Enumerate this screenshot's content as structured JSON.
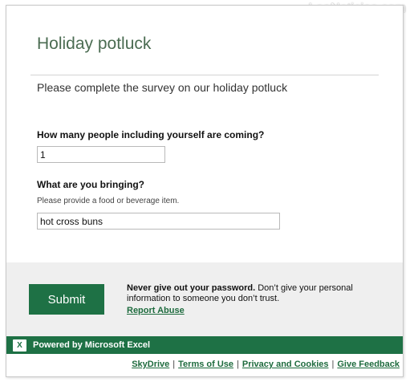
{
  "watermark": "LeaNoticias.com",
  "form": {
    "title": "Holiday potluck",
    "description": "Please complete the survey on our holiday potluck"
  },
  "questions": [
    {
      "label": "How many people including yourself are coming?",
      "help": "",
      "value": "1"
    },
    {
      "label": "What are you bringing?",
      "help": "Please provide a food or beverage item.",
      "value": "hot cross buns"
    }
  ],
  "footer": {
    "submit_label": "Submit",
    "notice_bold": "Never give out your password.",
    "notice_rest": " Don’t give your personal information to someone you don’t trust.",
    "report_abuse": "Report Abuse",
    "powered_by": "Powered by Microsoft Excel",
    "excel_icon_glyph": "X",
    "links": [
      "SkyDrive",
      "Terms of Use",
      "Privacy and Cookies",
      "Give Feedback"
    ]
  },
  "colors": {
    "brand_green": "#1e7145",
    "title_green": "#4b6c52"
  }
}
